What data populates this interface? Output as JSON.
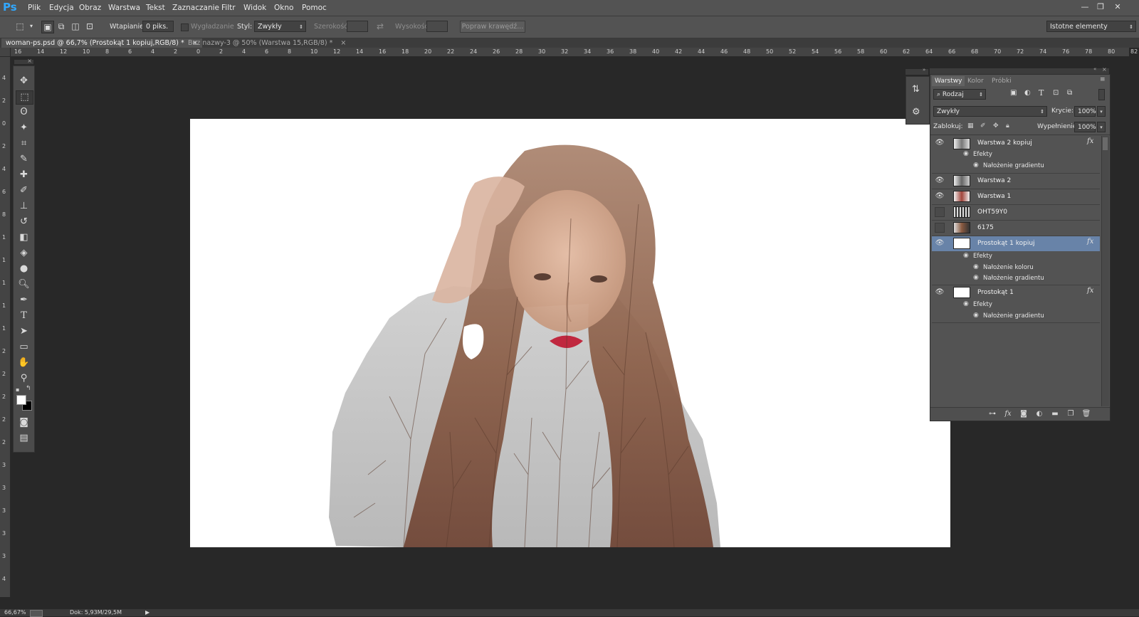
{
  "app": {
    "logo": "Ps"
  },
  "menu": [
    "Plik",
    "Edycja",
    "Obraz",
    "Warstwa",
    "Tekst",
    "Zaznaczanie",
    "Filtr",
    "Widok",
    "Okno",
    "Pomoc"
  ],
  "window_controls": {
    "minimize": "—",
    "restore": "❐",
    "close": "✕"
  },
  "options": {
    "feather_label": "Wtapianie:",
    "feather_value": "0 piks.",
    "antialias_label": "Wygładzanie",
    "style_label": "Styl:",
    "style_value": "Zwykły",
    "width_label": "Szerokość:",
    "height_label": "Wysokość:",
    "refine_button": "Popraw krawędź...",
    "workspace": "Istotne elementy"
  },
  "tabs": [
    {
      "label": "woman-ps.psd @ 66,7% (Prostokąt 1 kopiuj,RGB/8) *",
      "close": "×"
    },
    {
      "label": "Bez nazwy-3 @ 50% (Warstwa 15,RGB/8) *",
      "close": "×"
    }
  ],
  "ruler_h": [
    "16",
    "14",
    "12",
    "10",
    "8",
    "6",
    "4",
    "2",
    "0",
    "2",
    "4",
    "6",
    "8",
    "10",
    "12",
    "14",
    "16",
    "18",
    "20",
    "22",
    "24",
    "26",
    "28",
    "30",
    "32",
    "34",
    "36",
    "38",
    "40",
    "42",
    "44",
    "46",
    "48",
    "50",
    "52",
    "54",
    "56",
    "58",
    "60",
    "62",
    "64",
    "66",
    "68",
    "70",
    "72",
    "74",
    "76",
    "78",
    "80",
    "82"
  ],
  "ruler_v": [
    "4",
    "2",
    "0",
    "2",
    "4",
    "6",
    "8",
    "1",
    "1",
    "1",
    "1",
    "1",
    "2",
    "2",
    "2",
    "2",
    "2",
    "3",
    "3",
    "3",
    "3",
    "3",
    "4"
  ],
  "layers_panel": {
    "tabs": [
      "Warstwy",
      "Kolor",
      "Próbki"
    ],
    "filter_kind": "Rodzaj",
    "blend_mode": "Zwykły",
    "opacity_label": "Krycie:",
    "opacity_value": "100%",
    "lock_label": "Zablokuj:",
    "fill_label": "Wypełnienie:",
    "fill_value": "100%",
    "layers": [
      {
        "name": "Warstwa 2 kopiuj",
        "visible": true,
        "fx": "fx",
        "effects_label": "Efekty",
        "effects": [
          "Nałożenie gradientu"
        ]
      },
      {
        "name": "Warstwa 2",
        "visible": true
      },
      {
        "name": "Warstwa 1",
        "visible": true
      },
      {
        "name": "OHT59Y0",
        "visible": false
      },
      {
        "name": "6175",
        "visible": false
      },
      {
        "name": "Prostokąt 1 kopiuj",
        "visible": true,
        "selected": true,
        "fx": "fx",
        "effects_label": "Efekty",
        "effects": [
          "Nałożenie koloru",
          "Nałożenie gradientu"
        ]
      },
      {
        "name": "Prostokąt 1",
        "visible": true,
        "fx": "fx",
        "effects_label": "Efekty",
        "effects": [
          "Nałożenie gradientu"
        ]
      }
    ]
  },
  "status": {
    "zoom": "66,67%",
    "doc": "Dok: 5,93M/29,5M"
  },
  "colors": {
    "accent_selected": "#6883a8",
    "ps_blue": "#31a8ff",
    "lips": "#c0283f"
  }
}
